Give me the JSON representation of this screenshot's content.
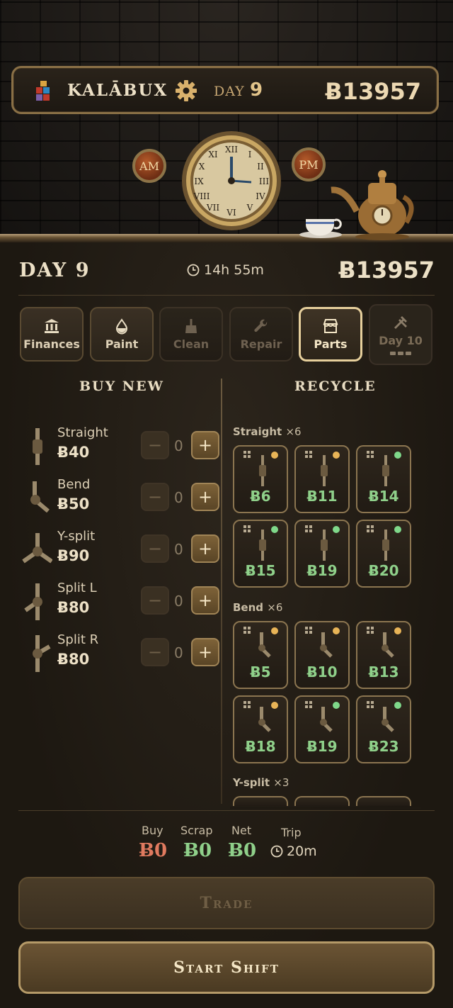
{
  "header": {
    "brand": "KALĀBUX",
    "day_label": "DAY",
    "day_number": "9",
    "cash": "Ƀ13957",
    "am_label": "AM",
    "pm_label": "PM"
  },
  "status": {
    "day": "DAY 9",
    "timer": "14h 55m",
    "cash": "Ƀ13957"
  },
  "tabs": [
    {
      "label": "Finances",
      "icon": "bank-icon",
      "state": "enabled"
    },
    {
      "label": "Paint",
      "icon": "paint-drop-icon",
      "state": "enabled"
    },
    {
      "label": "Clean",
      "icon": "broom-icon",
      "state": "disabled"
    },
    {
      "label": "Repair",
      "icon": "wrench-icon",
      "state": "disabled"
    },
    {
      "label": "Parts",
      "icon": "shop-icon",
      "state": "active"
    },
    {
      "label": "Day 10",
      "icon": "tools-icon",
      "state": "locked"
    }
  ],
  "buy": {
    "title": "BUY NEW",
    "items": [
      {
        "name": "Straight",
        "price": "Ƀ40",
        "qty": "0"
      },
      {
        "name": "Bend",
        "price": "Ƀ50",
        "qty": "0"
      },
      {
        "name": "Y-split",
        "price": "Ƀ90",
        "qty": "0"
      },
      {
        "name": "Split L",
        "price": "Ƀ80",
        "qty": "0"
      },
      {
        "name": "Split R",
        "price": "Ƀ80",
        "qty": "0"
      }
    ]
  },
  "recycle": {
    "title": "RECYCLE",
    "groups": [
      {
        "name": "Straight",
        "count": "×6",
        "cards": [
          {
            "value": "Ƀ6",
            "status": "orange"
          },
          {
            "value": "Ƀ11",
            "status": "orange"
          },
          {
            "value": "Ƀ14",
            "status": "green"
          },
          {
            "value": "Ƀ15",
            "status": "green"
          },
          {
            "value": "Ƀ19",
            "status": "green"
          },
          {
            "value": "Ƀ20",
            "status": "green"
          }
        ]
      },
      {
        "name": "Bend",
        "count": "×6",
        "cards": [
          {
            "value": "Ƀ5",
            "status": "orange"
          },
          {
            "value": "Ƀ10",
            "status": "orange"
          },
          {
            "value": "Ƀ13",
            "status": "orange"
          },
          {
            "value": "Ƀ18",
            "status": "orange"
          },
          {
            "value": "Ƀ19",
            "status": "green"
          },
          {
            "value": "Ƀ23",
            "status": "green"
          }
        ]
      },
      {
        "name": "Y-split",
        "count": "×3",
        "cards": []
      }
    ]
  },
  "summary": {
    "buy_label": "Buy",
    "buy_value": "Ƀ0",
    "scrap_label": "Scrap",
    "scrap_value": "Ƀ0",
    "net_label": "Net",
    "net_value": "Ƀ0",
    "trip_label": "Trip",
    "trip_value": "20m"
  },
  "actions": {
    "trade": "Trade",
    "start": "Start Shift"
  },
  "colors": {
    "accent": "#b59a68",
    "buy_value": "#e07a5f",
    "positive": "#8fd08a",
    "status_orange": "#e8b457",
    "status_green": "#7fd88a"
  }
}
